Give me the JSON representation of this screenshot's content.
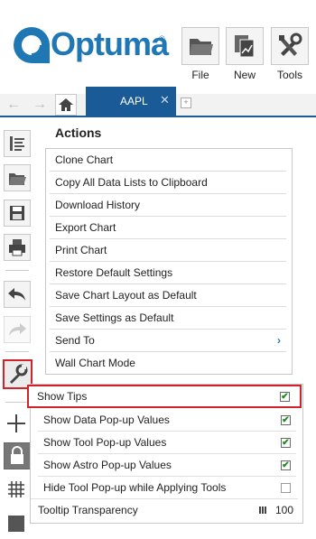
{
  "header": {
    "logo_text": "Optuma",
    "logo_reg": "®",
    "buttons": [
      {
        "label": "File",
        "icon": "folder-icon"
      },
      {
        "label": "New",
        "icon": "new-chart-icon"
      },
      {
        "label": "Tools",
        "icon": "tools-icon"
      }
    ]
  },
  "tabs": {
    "back": "←",
    "forward": "→",
    "active": "AAPL",
    "close": "✕",
    "add": "+"
  },
  "actions": {
    "title": "Actions",
    "items": [
      "Clone Chart",
      "Copy All Data Lists to Clipboard",
      "Download History",
      "Export Chart",
      "Print Chart",
      "Restore Default Settings",
      "Save Chart Layout as Default",
      "Save Settings as Default",
      "Send To",
      "Wall Chart Mode"
    ],
    "send_to_chevron": "›"
  },
  "settings": {
    "show_tips": {
      "label": "Show Tips",
      "checked": true
    },
    "options": [
      {
        "label": "Show Data Pop-up Values",
        "checked": true
      },
      {
        "label": "Show Tool Pop-up Values",
        "checked": true
      },
      {
        "label": "Show Astro Pop-up Values",
        "checked": true
      },
      {
        "label": "Hide Tool Pop-up while Applying Tools",
        "checked": false
      }
    ],
    "tooltip_transparency": {
      "label": "Tooltip Transparency",
      "value": "100"
    },
    "check_glyph": "✔"
  },
  "colors": {
    "brand": "#1f78b4",
    "tab": "#1a5a96",
    "highlight": "#d2232a",
    "check": "#1a8a1a"
  }
}
